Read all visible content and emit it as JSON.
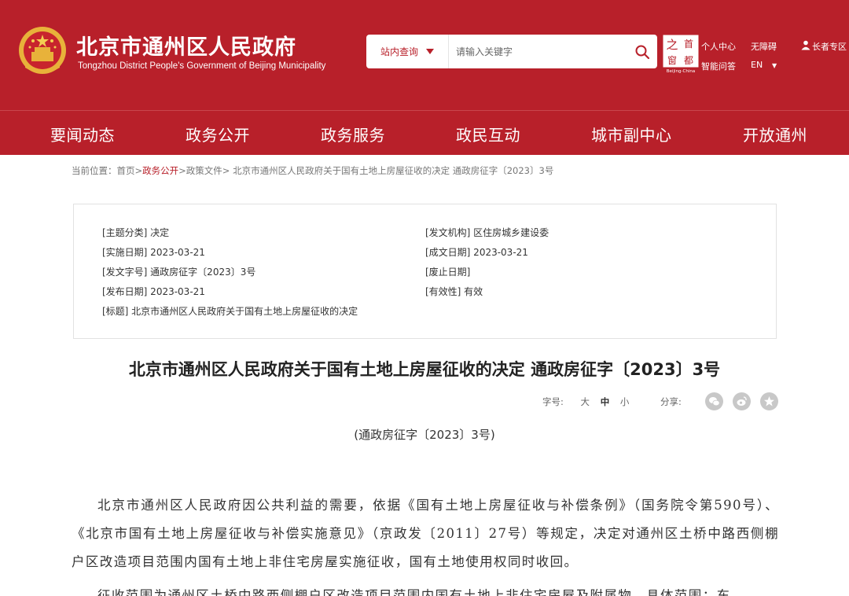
{
  "header": {
    "site_title": "北京市通州区人民政府",
    "site_subtitle": "Tongzhou District People's Government of Beijing Municipality",
    "search": {
      "scope_label": "站内查询",
      "placeholder": "请输入关键字"
    },
    "capital_logo_label": "Beijing-China",
    "links": {
      "personal_center": "个人中心",
      "accessibility": "无障碍",
      "elderly": "长者专区",
      "smart_qa": "智能问答",
      "language": "EN"
    }
  },
  "nav": [
    "要闻动态",
    "政务公开",
    "政务服务",
    "政民互动",
    "城市副中心",
    "开放通州"
  ],
  "breadcrumb": {
    "prefix": "当前位置：",
    "items": [
      "首页",
      "政务公开",
      "政策文件"
    ],
    "current": "北京市通州区人民政府关于国有土地上房屋征收的决定 通政房征字〔2023〕3号"
  },
  "info": {
    "topic": "[主题分类] 决定",
    "issuer": "[发文机构] 区住房城乡建设委",
    "effective_date": "[实施日期] 2023-03-21",
    "written_date": "[成文日期] 2023-03-21",
    "doc_no": "[发文字号] 通政房征字〔2023〕3号",
    "repeal_date": "[废止日期]",
    "publish_date": "[发布日期] 2023-03-21",
    "validity": "[有效性] 有效",
    "title": "[标题] 北京市通州区人民政府关于国有土地上房屋征收的决定"
  },
  "article": {
    "title": "北京市通州区人民政府关于国有土地上房屋征收的决定 通政房征字〔2023〕3号",
    "font_label": "字号:",
    "font_sizes": [
      "大",
      "中",
      "小"
    ],
    "share_label": "分享:",
    "doc_number": "(通政房征字〔2023〕3号)",
    "paragraph1": "北京市通州区人民政府因公共利益的需要，依据《国有土地上房屋征收与补偿条例》（国务院令第590号）、《北京市国有土地上房屋征收与补偿实施意见》（京政发〔2011〕27号）等规定，决定对通州区土桥中路西侧棚户区改造项目范围内国有土地上非住宅房屋实施征收，国有土地使用权同时收回。",
    "paragraph2": "征收范围为通州区土桥中路西侧棚户区改造项目范围内国有土地上非住宅房屋及附属物，具体范围：东"
  },
  "colors": {
    "brand_red": "#b8202a"
  }
}
